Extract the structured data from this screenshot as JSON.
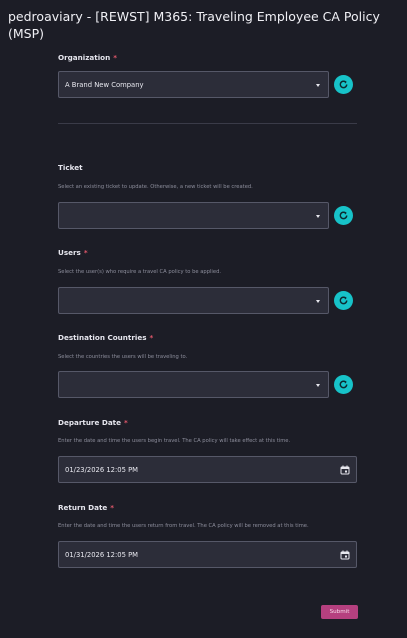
{
  "page": {
    "title": "pedroaviary - [REWST] M365: Traveling Employee CA Policy (MSP)"
  },
  "colors": {
    "background": "#1c1d26",
    "field_background": "#2c2d39",
    "refresh_accent": "#17c3c9",
    "required_marker": "#e0576a",
    "submit_button": "#b5407f"
  },
  "form": {
    "organization": {
      "label": "Organization",
      "required_mark": "*",
      "value": "A Brand New Company"
    },
    "ticket": {
      "label": "Ticket",
      "help": "Select an existing ticket to update. Otherwise, a new ticket will be created.",
      "value": ""
    },
    "users": {
      "label": "Users",
      "required_mark": "*",
      "help": "Select the user(s) who require a travel CA policy to be applied.",
      "value": ""
    },
    "destination_countries": {
      "label": "Destination Countries",
      "required_mark": "*",
      "help": "Select the countries the users will be traveling to.",
      "value": ""
    },
    "departure_date": {
      "label": "Departure Date",
      "required_mark": "*",
      "help": "Enter the date and time the users begin travel. The CA policy will take effect at this time.",
      "value": "01/23/2026 12:05 PM"
    },
    "return_date": {
      "label": "Return Date",
      "required_mark": "*",
      "help": "Enter the date and time the users return from travel. The CA policy will be removed at this time.",
      "value": "01/31/2026 12:05 PM"
    },
    "submit_label": "Submit"
  },
  "icons": {
    "refresh": "refresh-icon",
    "dropdown": "chevron-down-icon",
    "calendar": "calendar-icon"
  }
}
